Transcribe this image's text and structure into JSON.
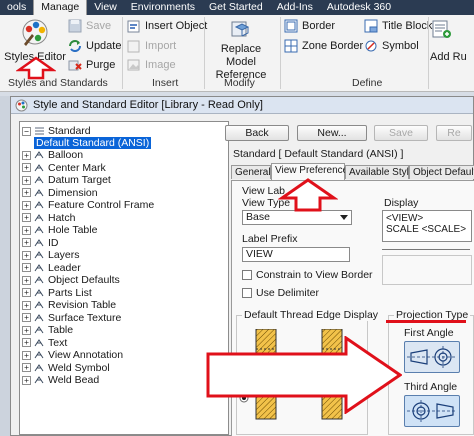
{
  "ribbon": {
    "tabs": [
      {
        "label": "ools",
        "active": false
      },
      {
        "label": "Manage",
        "active": true
      },
      {
        "label": "View",
        "active": false
      },
      {
        "label": "Environments",
        "active": false
      },
      {
        "label": "Get Started",
        "active": false
      },
      {
        "label": "Add-Ins",
        "active": false
      },
      {
        "label": "Autodesk 360",
        "active": false
      }
    ],
    "styles_group": {
      "styles_editor": "Styles Editor",
      "save": "Save",
      "update": "Update",
      "purge": "Purge",
      "label": "Styles and Standards"
    },
    "insert_group": {
      "insert_object": "Insert Object",
      "import": "Import",
      "image": "Image",
      "label": "Insert"
    },
    "modify_group": {
      "replace_model_reference": "Replace Model Reference",
      "label": "Modify"
    },
    "define_group": {
      "border": "Border",
      "zone_border": "Zone Border",
      "title_block": "Title Block",
      "symbol": "Symbol",
      "label": "Define"
    },
    "add_rule": "Add Ru"
  },
  "dialog": {
    "title": "Style and Standard Editor [Library - Read Only]",
    "buttons": {
      "back": "Back",
      "new": "New...",
      "save": "Save",
      "reset": "Re"
    },
    "standard_title": "Standard [ Default Standard (ANSI) ]",
    "tree": {
      "root": "Standard",
      "selected": "Default Standard (ANSI)",
      "items": [
        "Balloon",
        "Center Mark",
        "Datum Target",
        "Dimension",
        "Feature Control Frame",
        "Hatch",
        "Hole Table",
        "ID",
        "Layers",
        "Leader",
        "Object Defaults",
        "Parts List",
        "Revision Table",
        "Surface Texture",
        "Table",
        "Text",
        "View Annotation",
        "Weld Symbol",
        "Weld Bead"
      ]
    },
    "tabs": [
      {
        "label": "General",
        "active": false
      },
      {
        "label": "View Preferences",
        "active": true
      },
      {
        "label": "Available Styles",
        "active": false
      },
      {
        "label": "Object Defaults",
        "active": false
      }
    ],
    "view_label": {
      "group_title": "View Lab",
      "view_type_label": "View Type",
      "view_type_value": "Base",
      "display_label": "Display",
      "display_value": "<VIEW>\nSCALE <SCALE>",
      "label_prefix_label": "Label Prefix",
      "label_prefix_value": "VIEW",
      "constrain_label": "Constrain to View Border",
      "delimiter_label": "Use Delimiter"
    },
    "thread": {
      "title": "Default Thread Edge Display"
    },
    "projection": {
      "title": "Projection Type",
      "first_angle": "First Angle",
      "third_angle": "Third Angle"
    }
  },
  "colors": {
    "ribbon_tab_bar": "#2b3b52",
    "selection": "#0a64d8",
    "annotation_red": "#e0101a",
    "thread_hatch": "#f2c24a"
  }
}
